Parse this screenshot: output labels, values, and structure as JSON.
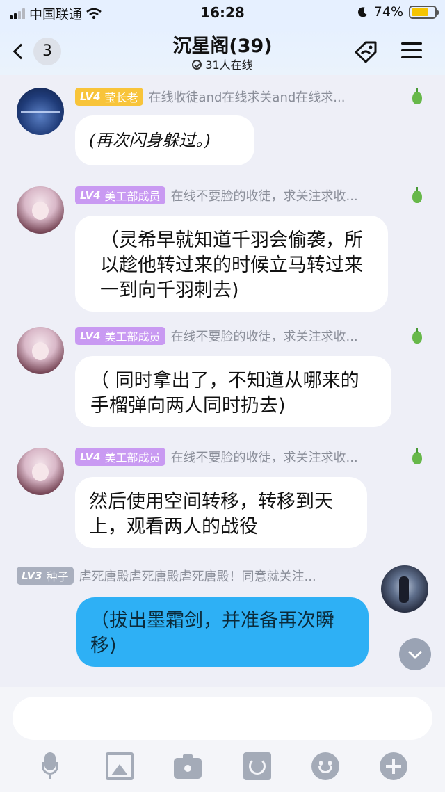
{
  "status_bar": {
    "carrier": "中国联通",
    "time": "16:28",
    "battery_percent": "74%",
    "battery_level": 0.74
  },
  "header": {
    "back_count": "3",
    "title": "沉星阁(39)",
    "online": "31人在线"
  },
  "messages": [
    {
      "level": "LV4",
      "role": "莹长老",
      "signature": "在线收徒and在线求关and在线求...",
      "text": "(再次闪身躲过。)"
    },
    {
      "level": "LV4",
      "role": "美工部成员",
      "signature": "在线不要脸的收徒，求关注求收...",
      "text": "（灵希早就知道千羽会偷袭，所以趁他转过来的时候立马转过来一到向千羽刺去)"
    },
    {
      "level": "LV4",
      "role": "美工部成员",
      "signature": "在线不要脸的收徒，求关注求收...",
      "text": "（ 同时拿出了，不知道从哪来的手榴弹向两人同时扔去)"
    },
    {
      "level": "LV4",
      "role": "美工部成员",
      "signature": "在线不要脸的收徒，求关注求收...",
      "text": "然后使用空间转移，转移到天上，观看两人的战役"
    },
    {
      "level": "LV3",
      "role": "种子",
      "signature": "虐死唐殿虐死唐殿虐死唐殿！同意就关注...",
      "text": "（拔出墨霜剑，并准备再次瞬移)"
    }
  ],
  "composer": {
    "placeholder": ""
  },
  "colors": {
    "gold_badge": "#f8c43a",
    "purple_badge": "#c99af2",
    "gray_badge": "#a9afbe",
    "own_bubble": "#2eb0f5"
  },
  "icons": {
    "toolbar": [
      "microphone-icon",
      "image-icon",
      "camera-icon",
      "red-envelope-icon",
      "emoji-icon",
      "plus-icon"
    ]
  }
}
